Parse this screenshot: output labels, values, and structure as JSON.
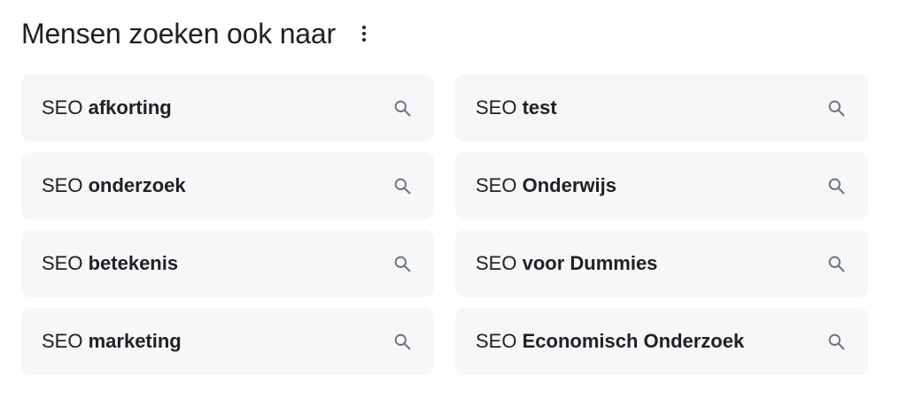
{
  "header": {
    "title": "Mensen zoeken ook naar",
    "more_icon": "more-vert-icon"
  },
  "colors": {
    "chip_background": "#f6f7f9",
    "text": "#202124",
    "icon": "#70757a"
  },
  "suggestions": [
    {
      "prefix": "SEO",
      "bold": "afkorting",
      "icon": "search-icon"
    },
    {
      "prefix": "SEO",
      "bold": "test",
      "icon": "search-icon"
    },
    {
      "prefix": "SEO",
      "bold": "onderzoek",
      "icon": "search-icon"
    },
    {
      "prefix": "SEO",
      "bold": "Onderwijs",
      "icon": "search-icon"
    },
    {
      "prefix": "SEO",
      "bold": "betekenis",
      "icon": "search-icon"
    },
    {
      "prefix": "SEO",
      "bold": "voor Dummies",
      "icon": "search-icon"
    },
    {
      "prefix": "SEO",
      "bold": "marketing",
      "icon": "search-icon"
    },
    {
      "prefix": "SEO",
      "bold": "Economisch Onderzoek",
      "icon": "search-icon"
    }
  ]
}
